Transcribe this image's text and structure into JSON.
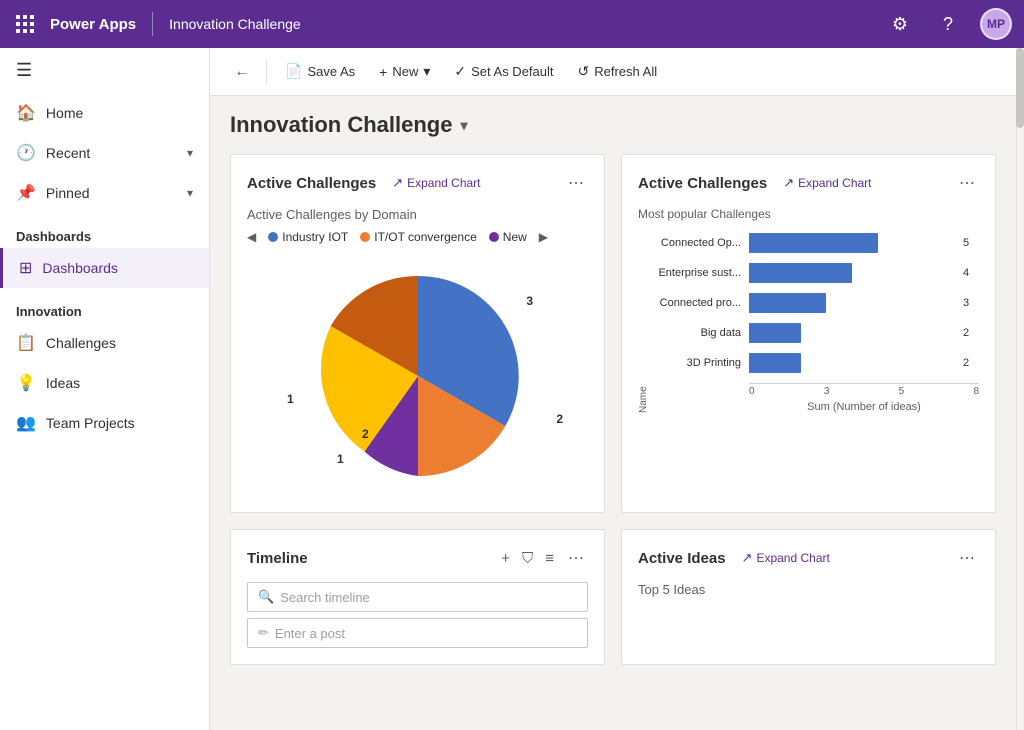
{
  "app": {
    "name": "Power Apps",
    "divider": "|",
    "module": "Innovation Challenge",
    "nav_icon_gear": "⚙",
    "nav_icon_help": "?",
    "avatar_initials": "MP"
  },
  "toolbar": {
    "back_label": "‹",
    "save_as_label": "Save As",
    "new_label": "New",
    "set_default_label": "Set As Default",
    "refresh_label": "Refresh All"
  },
  "page": {
    "title": "Innovation Challenge",
    "title_chevron": "▾"
  },
  "sidebar": {
    "hamburger": "☰",
    "items": [
      {
        "id": "home",
        "icon": "🏠",
        "label": "Home"
      },
      {
        "id": "recent",
        "icon": "🕐",
        "label": "Recent",
        "chevron": "▾"
      },
      {
        "id": "pinned",
        "icon": "📌",
        "label": "Pinned",
        "chevron": "▾"
      }
    ],
    "sections": [
      {
        "label": "Dashboards",
        "items": [
          {
            "id": "dashboards",
            "icon": "⊞",
            "label": "Dashboards",
            "active": true
          }
        ]
      },
      {
        "label": "Innovation",
        "items": [
          {
            "id": "challenges",
            "icon": "📋",
            "label": "Challenges"
          },
          {
            "id": "ideas",
            "icon": "💡",
            "label": "Ideas"
          },
          {
            "id": "team-projects",
            "icon": "👥",
            "label": "Team Projects"
          }
        ]
      }
    ]
  },
  "cards": {
    "active_challenges_pie": {
      "title": "Active Challenges",
      "expand_label": "Expand Chart",
      "subtitle": "Active Challenges by Domain",
      "legend": [
        {
          "label": "Industry IOT",
          "color": "#4472c4"
        },
        {
          "label": "IT/OT convergence",
          "color": "#ed7d31"
        },
        {
          "label": "New",
          "color": "#7030a0"
        }
      ],
      "pie_segments": [
        {
          "label": "3",
          "color": "#4472c4",
          "value": 3
        },
        {
          "label": "2",
          "color": "#ed7d31",
          "value": 2
        },
        {
          "label": "1",
          "color": "#7030a0",
          "value": 1
        },
        {
          "label": "1",
          "color": "#ffc000",
          "value": 1
        },
        {
          "label": "2",
          "color": "#ed7d31",
          "value": 2
        }
      ]
    },
    "active_challenges_bar": {
      "title": "Active Challenges",
      "expand_label": "Expand Chart",
      "subtitle": "Most popular Challenges",
      "y_axis_label": "Name",
      "x_axis_label": "Sum (Number of ideas)",
      "bars": [
        {
          "label": "Connected Op...",
          "value": 5,
          "max": 8
        },
        {
          "label": "Enterprise sust...",
          "value": 4,
          "max": 8
        },
        {
          "label": "Connected pro...",
          "value": 3,
          "max": 8
        },
        {
          "label": "Big data",
          "value": 2,
          "max": 8
        },
        {
          "label": "3D Printing",
          "value": 2,
          "max": 8
        }
      ],
      "x_ticks": [
        "0",
        "3",
        "5",
        "8"
      ]
    },
    "timeline": {
      "title": "Timeline",
      "search_placeholder": "Search timeline",
      "post_placeholder": "Enter a post"
    },
    "active_ideas": {
      "title": "Active Ideas",
      "expand_label": "Expand Chart",
      "subtitle": "Top 5 Ideas"
    }
  }
}
